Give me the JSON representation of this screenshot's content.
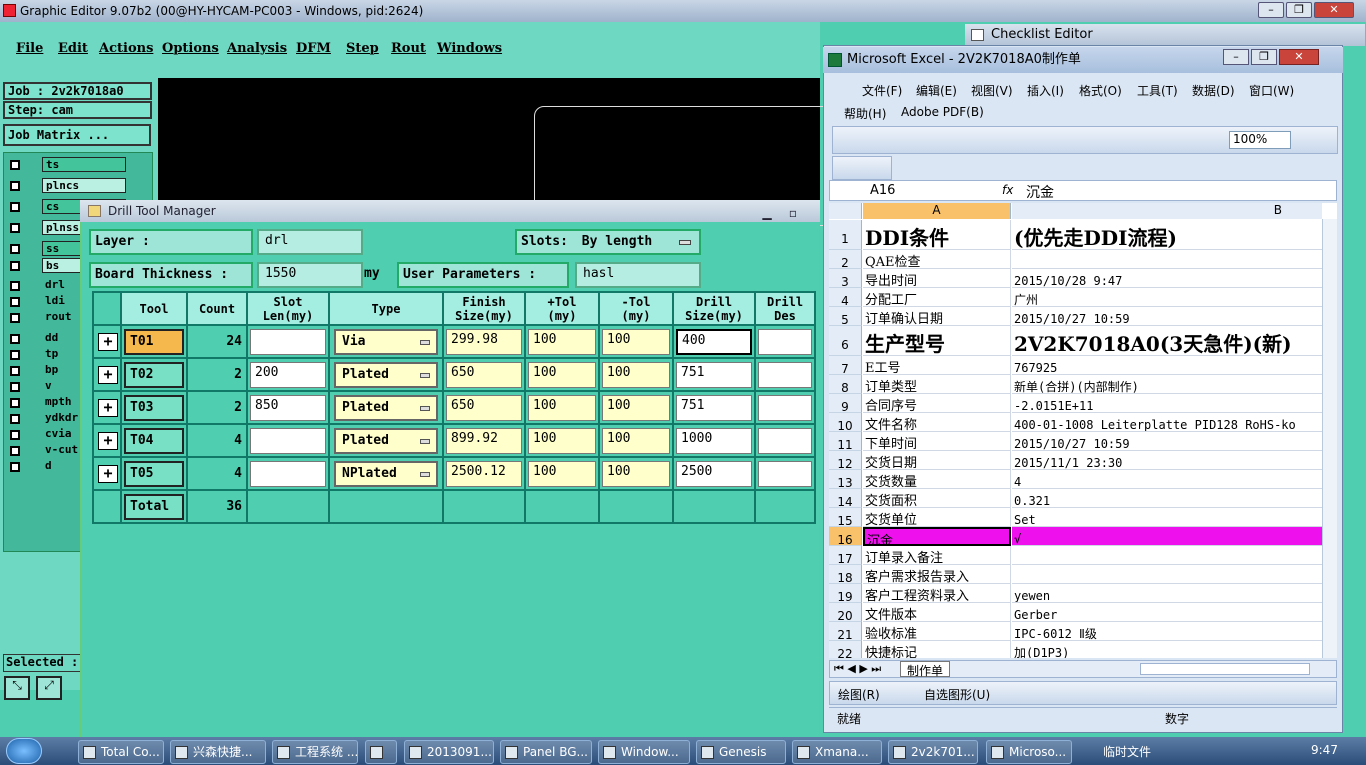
{
  "main_window": {
    "title": "Graphic Editor 9.07b2 (00@HY-HYCAM-PC003 - Windows, pid:2624)",
    "menu": [
      "File",
      "Edit",
      "Actions",
      "Options",
      "Analysis",
      "DFM",
      "Step",
      "Rout",
      "Windows"
    ]
  },
  "left_panel": {
    "job": "Job : 2v2k7018a0",
    "step": "Step: cam",
    "job_matrix": "Job Matrix ...",
    "layers": [
      "ts",
      "plncs",
      "cs",
      "plnss",
      "ss",
      "bs",
      "drl",
      "ldi",
      "rout",
      "dd",
      "tp",
      "bp",
      "v",
      "mpth",
      "ydkdr",
      "cvia",
      "v-cut",
      "d"
    ],
    "selected_label": "Selected :"
  },
  "drill_tool_manager": {
    "title": "Drill Tool Manager",
    "layer_label": "Layer        :",
    "layer_value": "drl",
    "slots_label": "Slots:",
    "slots_value": "By length",
    "board_thickness_label": "Board Thickness :",
    "board_thickness_value": "1550",
    "board_thickness_unit": "my",
    "user_params_label": "User Parameters :",
    "user_params_value": "hasl",
    "headers": {
      "tool": "Tool",
      "count": "Count",
      "slot": "Slot\nLen(my)",
      "type": "Type",
      "finish": "Finish\nSize(my)",
      "ptol": "+Tol\n(my)",
      "ntol": "-Tol\n(my)",
      "drill": "Drill\nSize(my)",
      "drill_des": "Drill\nDes"
    },
    "rows": [
      {
        "tool": "T01",
        "count": "24",
        "slot": "",
        "type": "Via",
        "finish": "299.98",
        "ptol": "100",
        "ntol": "100",
        "drill": "400"
      },
      {
        "tool": "T02",
        "count": "2",
        "slot": "200",
        "type": "Plated",
        "finish": "650",
        "ptol": "100",
        "ntol": "100",
        "drill": "751"
      },
      {
        "tool": "T03",
        "count": "2",
        "slot": "850",
        "type": "Plated",
        "finish": "650",
        "ptol": "100",
        "ntol": "100",
        "drill": "751"
      },
      {
        "tool": "T04",
        "count": "4",
        "slot": "",
        "type": "Plated",
        "finish": "899.92",
        "ptol": "100",
        "ntol": "100",
        "drill": "1000"
      },
      {
        "tool": "T05",
        "count": "4",
        "slot": "",
        "type": "NPlated",
        "finish": "2500.12",
        "ptol": "100",
        "ntol": "100",
        "drill": "2500"
      }
    ],
    "total_label": "Total",
    "total_value": "36"
  },
  "checklist_editor": {
    "title": "Checklist Editor"
  },
  "excel": {
    "title": "Microsoft Excel - 2V2K7018A0制作单",
    "menu1": [
      "文件(F)",
      "编辑(E)",
      "视图(V)",
      "插入(I)",
      "格式(O)",
      "工具(T)",
      "数据(D)",
      "窗口(W)"
    ],
    "menu2": [
      "帮助(H)",
      "Adobe PDF(B)"
    ],
    "zoom": "100%",
    "name_box": "A16",
    "fx": "fx",
    "formula": "沉金",
    "col_a": "A",
    "col_b": "B",
    "rows": [
      {
        "n": "1",
        "a": "DDI条件",
        "b": "(优先走DDI流程)",
        "big": true
      },
      {
        "n": "2",
        "a": "QAE检查",
        "b": ""
      },
      {
        "n": "3",
        "a": "导出时间",
        "b": "2015/10/28 9:47"
      },
      {
        "n": "4",
        "a": "分配工厂",
        "b": "广州"
      },
      {
        "n": "5",
        "a": "订单确认日期",
        "b": "2015/10/27 10:59"
      },
      {
        "n": "6",
        "a": "生产型号",
        "b": "2V2K7018A0(3天急件)(新)",
        "big": true
      },
      {
        "n": "7",
        "a": "E工号",
        "b": "767925"
      },
      {
        "n": "8",
        "a": "订单类型",
        "b": "新单(合拼)(内部制作)"
      },
      {
        "n": "9",
        "a": "合同序号",
        "b": "-2.0151E+11"
      },
      {
        "n": "10",
        "a": "文件名称",
        "b": "400-01-1008 Leiterplatte PID128 RoHS-ko"
      },
      {
        "n": "11",
        "a": "下单时间",
        "b": "2015/10/27 10:59"
      },
      {
        "n": "12",
        "a": "交货日期",
        "b": "2015/11/1 23:30"
      },
      {
        "n": "13",
        "a": "交货数量",
        "b": "4"
      },
      {
        "n": "14",
        "a": "交货面积",
        "b": "0.321"
      },
      {
        "n": "15",
        "a": "交货单位",
        "b": "Set"
      },
      {
        "n": "16",
        "a": "沉金",
        "b": "√",
        "hl": true
      },
      {
        "n": "17",
        "a": "订单录入备注",
        "b": ""
      },
      {
        "n": "18",
        "a": "客户需求报告录入",
        "b": ""
      },
      {
        "n": "19",
        "a": "客户工程资料录入",
        "b": "yewen"
      },
      {
        "n": "20",
        "a": "文件版本",
        "b": "Gerber"
      },
      {
        "n": "21",
        "a": "验收标准",
        "b": "IPC-6012 Ⅱ级"
      },
      {
        "n": "22",
        "a": "快捷标记",
        "b": "加(D1P3)"
      }
    ],
    "sheet_tab": "制作单",
    "draw_label": "绘图(R)",
    "autoshape_label": "自选图形(U)",
    "status": "就绪",
    "status_num": "数字"
  },
  "taskbar": {
    "items": [
      "Total Co...",
      "兴森快捷...",
      "工程系统 ...",
      "",
      "2013091...",
      "Panel BG...",
      "Window...",
      "Genesis",
      "Xmana...",
      "2v2k701...",
      "Microso..."
    ],
    "tray_label": "临时文件",
    "time": "9:47"
  },
  "colors": {
    "teal": "#4fcfb0",
    "highlight_magenta": "#ee11ee",
    "selected_tool": "#f5b84c"
  }
}
